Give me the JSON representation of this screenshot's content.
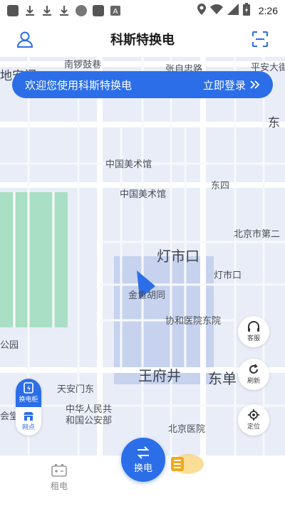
{
  "status_bar": {
    "time": "2:26",
    "icons": [
      "app-icon",
      "download-icon",
      "download-icon",
      "download-icon",
      "cat-app-icon",
      "app-icon",
      "font-a-icon",
      "location-icon",
      "wifi-icon",
      "signal-icon",
      "battery-charging-icon"
    ]
  },
  "header": {
    "title": "科斯特换电",
    "left_icon": "profile-icon",
    "right_icon": "scan-icon"
  },
  "banner": {
    "text": "欢迎您使用科斯特换电",
    "action": "立即登录",
    "action_icon": "double-chevron-right-icon"
  },
  "map": {
    "labels": {
      "l1": "南锣鼓巷",
      "l2": "张自忠路",
      "l3": "平安大街",
      "l4": "地安门",
      "l5": "东",
      "l6": "中国美术馆",
      "l7": "中国美术馆",
      "l8": "东四",
      "l9": "北京市第二",
      "l10": "灯市口",
      "l11": "灯市口",
      "l12": "金鱼胡同",
      "l13": "协和医院东院",
      "l14": "公园",
      "l15": "王府井",
      "l16": "东单",
      "l17": "天安门东",
      "l18": "中华人民共",
      "l19": "和国公安部",
      "l20": "北京医院",
      "l21": "会堂"
    },
    "colors": {
      "background": "#e9edf7",
      "park": "#a9dfc4",
      "road": "#ffffff",
      "highlight": "#c6d2ee"
    }
  },
  "side_buttons": {
    "service": "客服",
    "refresh": "刷新",
    "locate": "定位"
  },
  "left_filter": {
    "cabinet": "换电柜",
    "outlet": "网点"
  },
  "bottom_nav": {
    "rent": "租电",
    "swap": "换电"
  },
  "accent_color": "#2b6ee8"
}
